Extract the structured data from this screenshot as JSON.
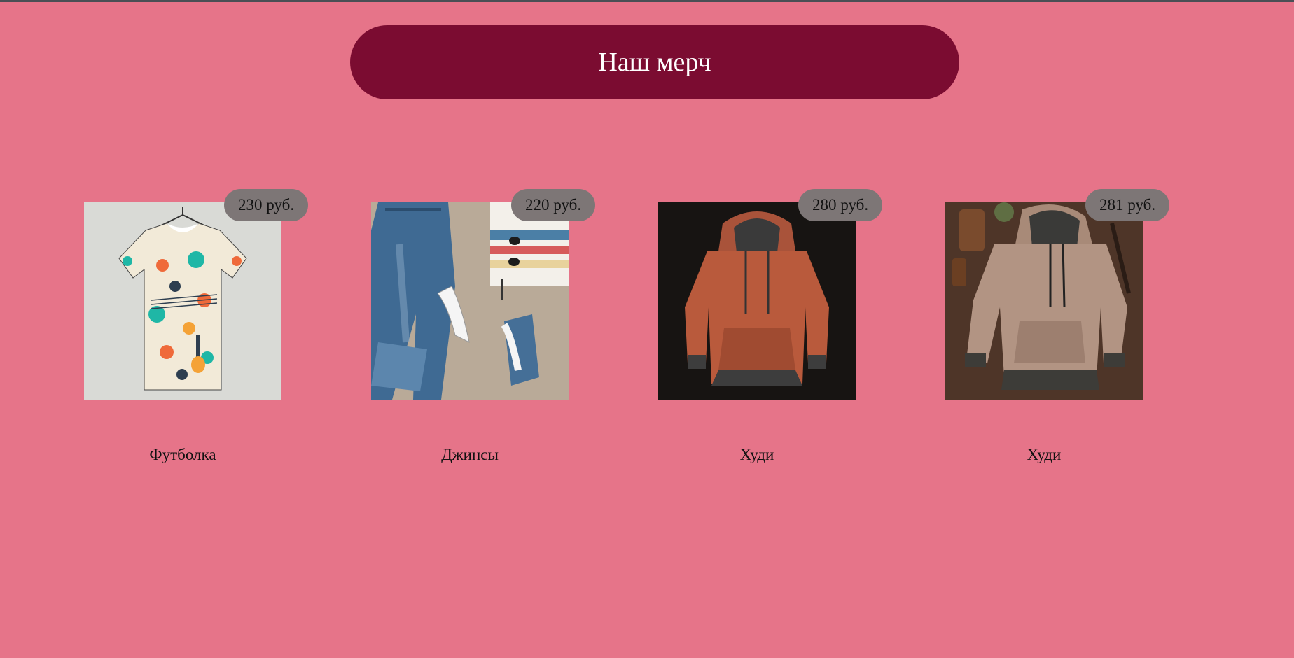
{
  "header": {
    "title": "Наш мерч"
  },
  "colors": {
    "background": "#e67489",
    "header": "#7b0c31",
    "price_badge": "#7d7676"
  },
  "products": [
    {
      "name": "Футболка",
      "price": "230 руб.",
      "image": "tshirt-photo"
    },
    {
      "name": "Джинсы",
      "price": "220 руб.",
      "image": "jeans-photo"
    },
    {
      "name": "Худи",
      "price": "280 руб.",
      "image": "orange-hoodie-photo"
    },
    {
      "name": "Худи",
      "price": "281 руб.",
      "image": "beige-hoodie-photo"
    }
  ]
}
